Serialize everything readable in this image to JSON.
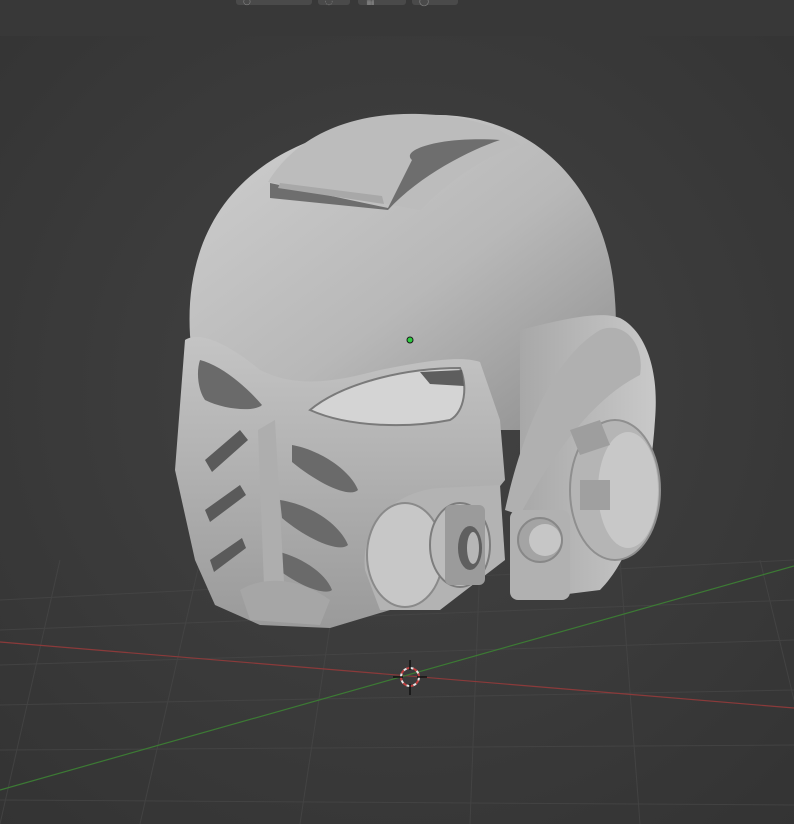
{
  "app": {
    "name": "3D viewport",
    "background_color": "#3a3a3a",
    "grid_color": "#454545"
  },
  "header": {
    "tools": [
      {
        "name": "view-shading-icon",
        "icon": "sphere-icon"
      },
      {
        "name": "overlay-icon",
        "icon": "circle-overlay-icon"
      },
      {
        "name": "shading-menu-icon",
        "icon": "grid-shading-icon"
      },
      {
        "name": "render-preview-icon",
        "icon": "render-circle-icon"
      }
    ]
  },
  "scene": {
    "object": "helmet",
    "object_color": "#bdbdbd",
    "x_axis_color": "#8b3a3a",
    "y_axis_color": "#3c7a34",
    "cursor_color": "#e6e6e6"
  }
}
